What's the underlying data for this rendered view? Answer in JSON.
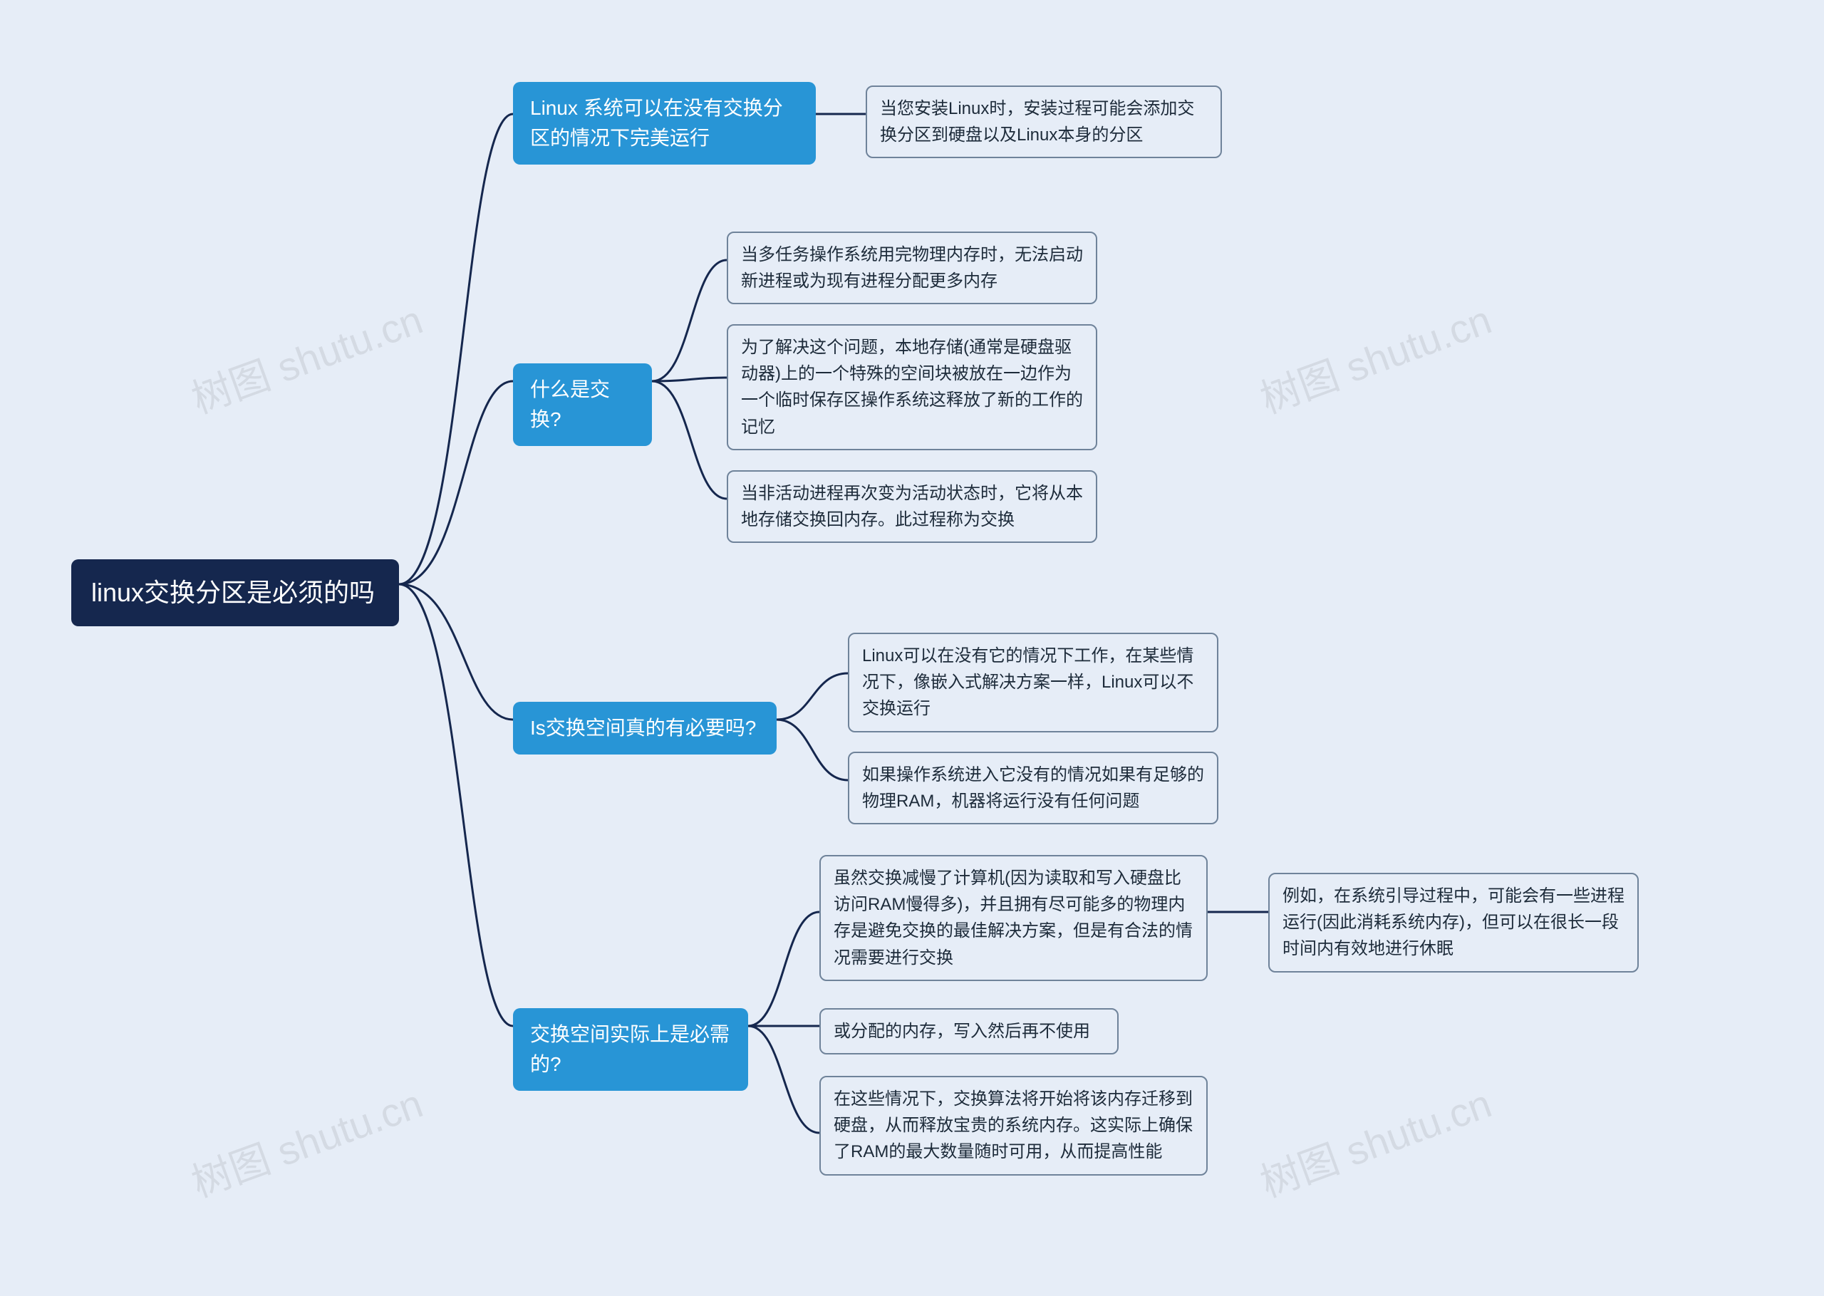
{
  "style": {
    "background": "#e6edf7",
    "connector_color": "#15274e",
    "root_bg": "#15274e",
    "root_fg": "#ffffff",
    "branch_bg": "#2895d6",
    "branch_fg": "#ffffff",
    "leaf_bg": "#e6edf7",
    "leaf_fg": "#1d2b3a",
    "leaf_border": "#6f839a"
  },
  "watermark_text": "树图 shutu.cn",
  "root": {
    "text": "linux交换分区是必须的吗"
  },
  "branches": [
    {
      "id": "b1",
      "text": "Linux 系统可以在没有交换分区的情况下完美运行",
      "children": [
        {
          "id": "b1c1",
          "text": "当您安装Linux时，安装过程可能会添加交换分区到硬盘以及Linux本身的分区"
        }
      ]
    },
    {
      "id": "b2",
      "text": "什么是交换?",
      "children": [
        {
          "id": "b2c1",
          "text": "当多任务操作系统用完物理内存时，无法启动新进程或为现有进程分配更多内存"
        },
        {
          "id": "b2c2",
          "text": "为了解决这个问题，本地存储(通常是硬盘驱动器)上的一个特殊的空间块被放在一边作为一个临时保存区操作系统这释放了新的工作的记忆"
        },
        {
          "id": "b2c3",
          "text": "当非活动进程再次变为活动状态时，它将从本地存储交换回内存。此过程称为交换"
        }
      ]
    },
    {
      "id": "b3",
      "text": "Is交换空间真的有必要吗?",
      "children": [
        {
          "id": "b3c1",
          "text": "Linux可以在没有它的情况下工作，在某些情况下，像嵌入式解决方案一样，Linux可以不交换运行"
        },
        {
          "id": "b3c2",
          "text": "如果操作系统进入它没有的情况如果有足够的物理RAM，机器将运行没有任何问题"
        }
      ]
    },
    {
      "id": "b4",
      "text": "交换空间实际上是必需的?",
      "children": [
        {
          "id": "b4c1",
          "text": "虽然交换减慢了计算机(因为读取和写入硬盘比访问RAM慢得多)，并且拥有尽可能多的物理内存是避免交换的最佳解决方案，但是有合法的情况需要进行交换",
          "children": [
            {
              "id": "b4c1g1",
              "text": "例如，在系统引导过程中，可能会有一些进程运行(因此消耗系统内存)，但可以在很长一段时间内有效地进行休眠"
            }
          ]
        },
        {
          "id": "b4c2",
          "text": "或分配的内存，写入然后再不使用"
        },
        {
          "id": "b4c3",
          "text": "在这些情况下，交换算法将开始将该内存迁移到硬盘，从而释放宝贵的系统内存。这实际上确保了RAM的最大数量随时可用，从而提高性能"
        }
      ]
    }
  ]
}
